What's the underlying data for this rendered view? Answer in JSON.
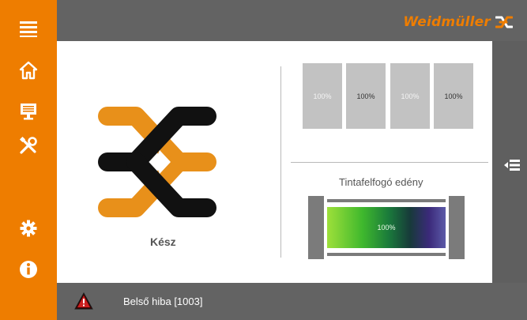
{
  "brand": {
    "name": "Weidmüller",
    "accent": "#ee7d00"
  },
  "sidebar": {
    "color": "#ee7d00",
    "items": [
      {
        "icon": "menu-icon"
      },
      {
        "icon": "home-icon"
      },
      {
        "icon": "monitor-icon"
      },
      {
        "icon": "tools-icon"
      },
      {
        "icon": "settings-icon"
      },
      {
        "icon": "info-icon"
      }
    ]
  },
  "status": {
    "label": "Kész"
  },
  "ink_levels": [
    {
      "value": "100%"
    },
    {
      "value": "100%"
    },
    {
      "value": "100%"
    },
    {
      "value": "100%"
    }
  ],
  "waste_container": {
    "title": "Tintafelfogó edény",
    "level": "100%"
  },
  "error": {
    "message": "Belső hiba [1003]"
  },
  "right_actions": [
    {
      "icon": "collapse-list-icon"
    },
    {
      "icon": "list-icon"
    }
  ]
}
